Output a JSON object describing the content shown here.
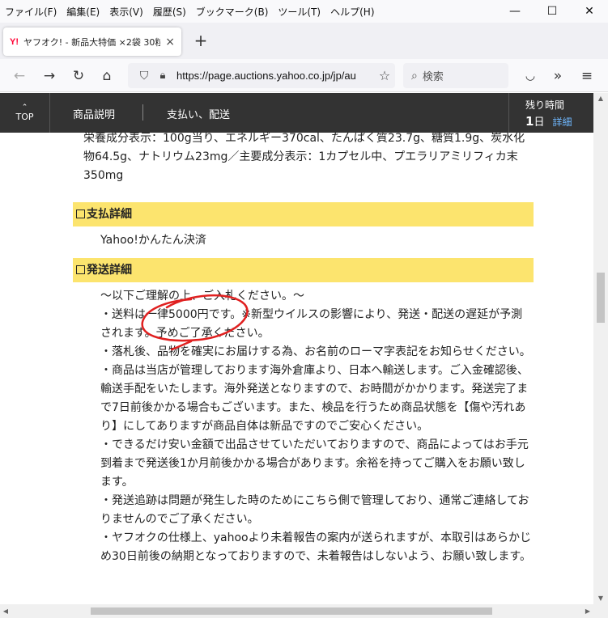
{
  "menu": [
    "ファイル(F)",
    "編集(E)",
    "表示(V)",
    "履歴(S)",
    "ブックマーク(B)",
    "ツール(T)",
    "ヘルプ(H)"
  ],
  "tab": {
    "favicon": "Y!",
    "title": "ヤフオク! - 新品大特価 ×2袋 30粒",
    "close": "×"
  },
  "newtab": "+",
  "nav": {
    "back_icon": "←",
    "forward_icon": "→",
    "reload_icon": "↻",
    "home_icon": "⌂",
    "url": "https://page.auctions.yahoo.co.jp/jp/au",
    "search_placeholder": "検索"
  },
  "header": {
    "top_label": "TOP",
    "nav_description": "商品説明",
    "nav_payment": "支払い、配送",
    "remain_label": "残り時間",
    "remain_value": "1",
    "remain_unit": "日",
    "remain_detail": "詳細"
  },
  "content": {
    "nutrition": "栄養成分表示：100g当り、エネルギー370cal、たんぱく質23.7g、糖質1.9g、炭水化物64.5g、ナトリウム23mg／主要成分表示：1カプセル中、プエラリアミリフィカ末350mg",
    "payment_heading": "支払詳細",
    "payment_method": "Yahoo!かんたん決済",
    "shipping_heading": "発送詳細",
    "shipping_lines": [
      "～以下ご理解の上、ご入札ください。～",
      "・送料は一律5000円です。※新型ウイルスの影響により、発送・配送の遅延が予測されます。予めご了承ください。",
      "・落札後、品物を確実にお届けする為、お名前のローマ字表記をお知らせください。",
      "・商品は当店が管理しております海外倉庫より、日本へ輸送します。ご入金確認後、輸送手配をいたします。海外発送となりますので、お時間がかかります。発送完了まで7日前後かかる場合もございます。また、検品を行うため商品状態を【傷や汚れあり】にしてありますが商品自体は新品ですのでご安心ください。",
      "・できるだけ安い金額で出品させていただいておりますので、商品によってはお手元到着まで発送後1か月前後かかる場合があります。余裕を持ってご購入をお願い致します。",
      "・発送追跡は問題が発生した時のためにこちら側で管理しており、通常ご連絡しておりませんのでご了承ください。",
      "・ヤフオクの仕様上、yahooより未着報告の案内が送られますが、本取引はあらかじめ30日前後の納期となっておりますので、未着報告はしないよう、お願い致します。"
    ]
  },
  "colors": {
    "section_bar": "#fce46e",
    "header_bg": "#333333",
    "annotation": "#e02020"
  }
}
